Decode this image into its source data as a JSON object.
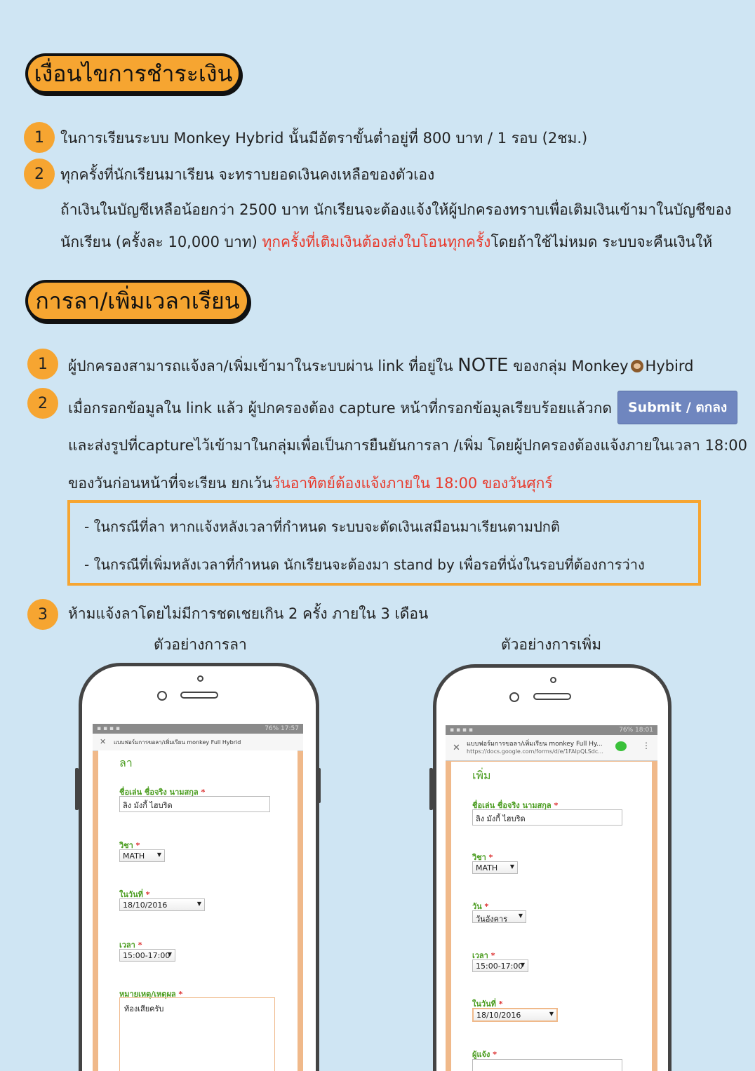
{
  "section1": {
    "heading": "เงื่อนไขการชำระเงิน",
    "items": [
      {
        "num": "1",
        "text": "ในการเรียนระบบ Monkey Hybrid นั้นมีอัตราขั้นต่ำอยู่ที่ 800 บาท / 1 รอบ (2ชม.)"
      },
      {
        "num": "2",
        "text": "ทุกครั้งที่นักเรียนมาเรียน จะทราบยอดเงินคงเหลือของตัวเอง"
      }
    ],
    "para_line1": "ถ้าเงินในบัญชีเหลือน้อยกว่า 2500 บาท นักเรียนจะต้องแจ้งให้ผู้ปกครองทราบเพื่อเติมเงินเข้ามาในบัญชีของ",
    "para_line2_a": "นักเรียน (ครั้งละ 10,000 บาท) ",
    "para_line2_red": "ทุกครั้งที่เติมเงินต้องส่งใบโอนทุกครั้ง",
    "para_line2_b": "โดยถ้าใช้ไม่หมด ระบบจะคืนเงินให้"
  },
  "section2": {
    "heading": "การลา/เพิ่มเวลาเรียน",
    "item1_num": "1",
    "item1_a": "ผู้ปกครองสามารถแจ้งลา/เพิ่มเข้ามาในระบบผ่าน link ที่อยู่ใน ",
    "item1_note": "NOTE",
    "item1_b": " ของกลุ่ม Monkey",
    "item1_c": "Hybird",
    "item2_num": "2",
    "item2_line1": "เมื่อกรอกข้อมูลใน link แล้ว ผู้ปกครองต้อง capture หน้าที่กรอกข้อมูลเรียบร้อยแล้วกด",
    "submit_label": "Submit / ตกลง",
    "item2_line2": "และส่งรูปที่captureไว้เข้ามาในกลุ่มเพื่อเป็นการยืนยันการลา /เพิ่ม โดยผู้ปกครองต้องแจ้งภายในเวลา 18:00",
    "item2_line3_a": "ของวันก่อนหน้าที่จะเรียน ยกเว้น",
    "item2_line3_red": "วันอาทิตย์ต้องแจ้งภายใน 18:00 ของวันศุกร์",
    "bullets": [
      "-   ในกรณีที่ลา หากแจ้งหลังเวลาที่กำหนด ระบบจะตัดเงินเสมือนมาเรียนตามปกติ",
      "-   ในกรณีที่เพิ่มหลังเวลาที่กำหนด นักเรียนจะต้องมา stand by เพื่อรอที่นั่งในรอบที่ต้องการว่าง"
    ],
    "item3_num": "3",
    "item3_text": "ห้ามแจ้งลาโดยไม่มีการชดเชยเกิน 2 ครั้ง ภายใน 3 เดือน",
    "caption_left": "ตัวอย่างการลา",
    "caption_right": "ตัวอย่างการเพิ่ม"
  },
  "phone_left": {
    "status": "76%  17:57",
    "tab_title": "แบบฟอร์มการขอลา/เพิ่มเรียน monkey Full Hybrid",
    "form_title": "ลา",
    "name_label": "ชื่อเล่น ชื่อจริง นามสกุล",
    "name_value": "ลิง มังกี้ ไฮบริด",
    "subject_label": "วิชา",
    "subject_value": "MATH",
    "date_label": "ในวันที่",
    "date_value": "18/10/2016",
    "time_label": "เวลา",
    "time_value": "15:00-17:00",
    "reason_label": "หมายเหตุ/เหตุผล",
    "reason_value": "ท้องเสียครับ"
  },
  "phone_right": {
    "status": "76%  18:01",
    "tab_title": "แบบฟอร์มการขอลา/เพิ่มเรียน monkey Full Hy...",
    "url": "https://docs.google.com/forms/d/e/1FAIpQLSdc...",
    "form_title": "เพิ่ม",
    "name_label": "ชื่อเล่น ชื่อจริง นามสกุล",
    "name_value": "ลิง มังกี้ ไฮบริด",
    "subject_label": "วิชา",
    "subject_value": "MATH",
    "day_label": "วัน",
    "day_value": "วันอังคาร",
    "time_label": "เวลา",
    "time_value": "15:00-17:00",
    "date_label": "ในวันที่",
    "date_value": "18/10/2016",
    "notify_label": "ผู้แจ้ง"
  },
  "colors": {
    "background": "#cfe5f3",
    "accent": "#f6a531",
    "red": "#e8392b",
    "submit": "#6f86bf",
    "form_green": "#4a9c1f"
  }
}
